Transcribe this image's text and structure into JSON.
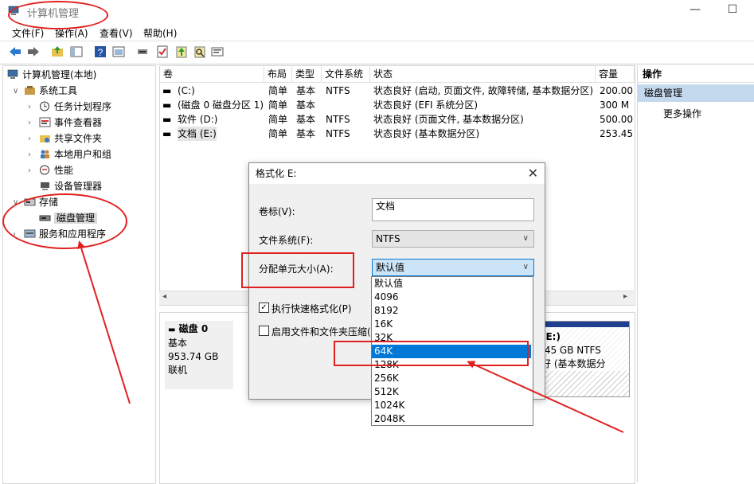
{
  "window": {
    "title": "计算机管理",
    "minimize_glyph": "—",
    "maximize_glyph": "☐"
  },
  "menu": [
    "文件(F)",
    "操作(A)",
    "查看(V)",
    "帮助(H)"
  ],
  "toolbar_icons": [
    "back-icon",
    "forward-icon",
    "up-folder-icon",
    "show-tree-icon",
    "help-icon",
    "properties-icon",
    "connect-icon",
    "check-icon",
    "upload-icon",
    "search-icon",
    "info-icon"
  ],
  "tree": {
    "root": "计算机管理(本地)",
    "system_tools": "系统工具",
    "items": [
      "任务计划程序",
      "事件查看器",
      "共享文件夹",
      "本地用户和组",
      "性能",
      "设备管理器"
    ],
    "storage": "存储",
    "disk_mgmt": "磁盘管理",
    "services": "服务和应用程序"
  },
  "table": {
    "headers": [
      "卷",
      "布局",
      "类型",
      "文件系统",
      "状态",
      "容量"
    ],
    "rows": [
      {
        "vol": "(C:)",
        "layout": "简单",
        "type": "基本",
        "fs": "NTFS",
        "status": "状态良好 (启动, 页面文件, 故障转储, 基本数据分区)",
        "cap": "200.00"
      },
      {
        "vol": "(磁盘 0 磁盘分区 1)",
        "layout": "简单",
        "type": "基本",
        "fs": "",
        "status": "状态良好 (EFI 系统分区)",
        "cap": "300 M"
      },
      {
        "vol": "软件 (D:)",
        "layout": "简单",
        "type": "基本",
        "fs": "NTFS",
        "status": "状态良好 (页面文件, 基本数据分区)",
        "cap": "500.00"
      },
      {
        "vol": "文档 (E:)",
        "layout": "简单",
        "type": "基本",
        "fs": "NTFS",
        "status": "状态良好 (基本数据分区)",
        "cap": "253.45"
      }
    ]
  },
  "disk": {
    "name": "磁盘 0",
    "type": "基本",
    "size": "953.74 GB",
    "status": "联机",
    "partition_name": "(E:)",
    "partition_size": ".45 GB NTFS",
    "partition_status": "好 (基本数据分"
  },
  "actions": {
    "header": "操作",
    "selected": "磁盘管理",
    "more": "更多操作"
  },
  "dialog": {
    "title": "格式化 E:",
    "volume_label": "卷标(V):",
    "volume_value": "文档",
    "fs_label": "文件系统(F):",
    "fs_value": "NTFS",
    "alloc_label": "分配单元大小(A):",
    "alloc_value": "默认值",
    "quick_format": "执行快速格式化(P)",
    "compression": "启用文件和文件夹压缩(",
    "options": [
      "默认值",
      "4096",
      "8192",
      "16K",
      "32K",
      "64K",
      "128K",
      "256K",
      "512K",
      "1024K",
      "2048K"
    ],
    "selected_option": "64K"
  },
  "annotation_color": "#e02020"
}
